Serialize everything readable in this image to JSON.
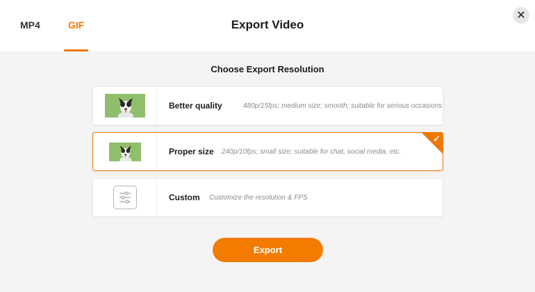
{
  "header": {
    "tabs": [
      {
        "label": "MP4",
        "active": false
      },
      {
        "label": "GIF",
        "active": true
      }
    ],
    "title": "Export Video",
    "close_icon": "close-icon"
  },
  "main": {
    "subtitle": "Choose Export Resolution",
    "options": [
      {
        "name": "Better quality",
        "description": "480p/15fps; medium size; smooth; suitable for serious occasions.",
        "selected": false,
        "icon": "dog-thumbnail"
      },
      {
        "name": "Proper size",
        "description": "240p/10fps; small size; suitable for chat, social media, etc.",
        "selected": true,
        "icon": "dog-thumbnail"
      },
      {
        "name": "Custom",
        "description": "Customize the resolution & FPS",
        "selected": false,
        "icon": "sliders-icon"
      }
    ],
    "export_label": "Export"
  },
  "colors": {
    "accent": "#f07800",
    "export_button": "#f37b00",
    "background": "#f4f4f4",
    "thumbnail_green": "#8fbf6a"
  }
}
